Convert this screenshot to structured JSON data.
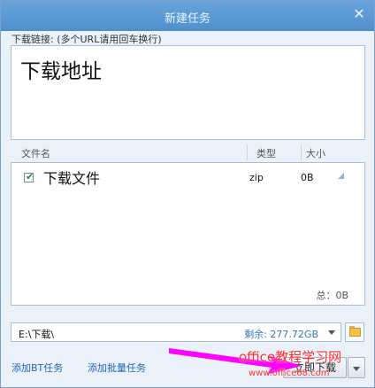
{
  "dialog": {
    "title": "新建任务",
    "close_glyph": "✕"
  },
  "url_input": {
    "label": "下载链接: (多个URL请用回车换行)",
    "value": "下载地址"
  },
  "file_list": {
    "columns": [
      "文件名",
      "类型",
      "大小"
    ],
    "rows": [
      {
        "checked": true,
        "name": "下载文件",
        "type": "zip",
        "size": "0B"
      }
    ],
    "total": "总：0B"
  },
  "save_path": {
    "path": "E:\\下载\\",
    "free_space": "剩余: 277.72GB"
  },
  "footer": {
    "add_bt_label": "添加BT任务",
    "add_batch_label": "添加批量任务",
    "download_now_label": "立即下载"
  },
  "watermark": {
    "line1": "office教程学习网",
    "line2": "www.office68.com"
  },
  "colors": {
    "titlebar": "#5a9ad3",
    "link": "#2266bb",
    "free_space": "#3377bb",
    "annotation": "#ff00ff",
    "watermark": "#ff2e2e"
  },
  "icons": [
    "close-icon",
    "checkbox-checked-icon",
    "resize-corner-icon",
    "dropdown-arrow-icon",
    "folder-icon"
  ]
}
